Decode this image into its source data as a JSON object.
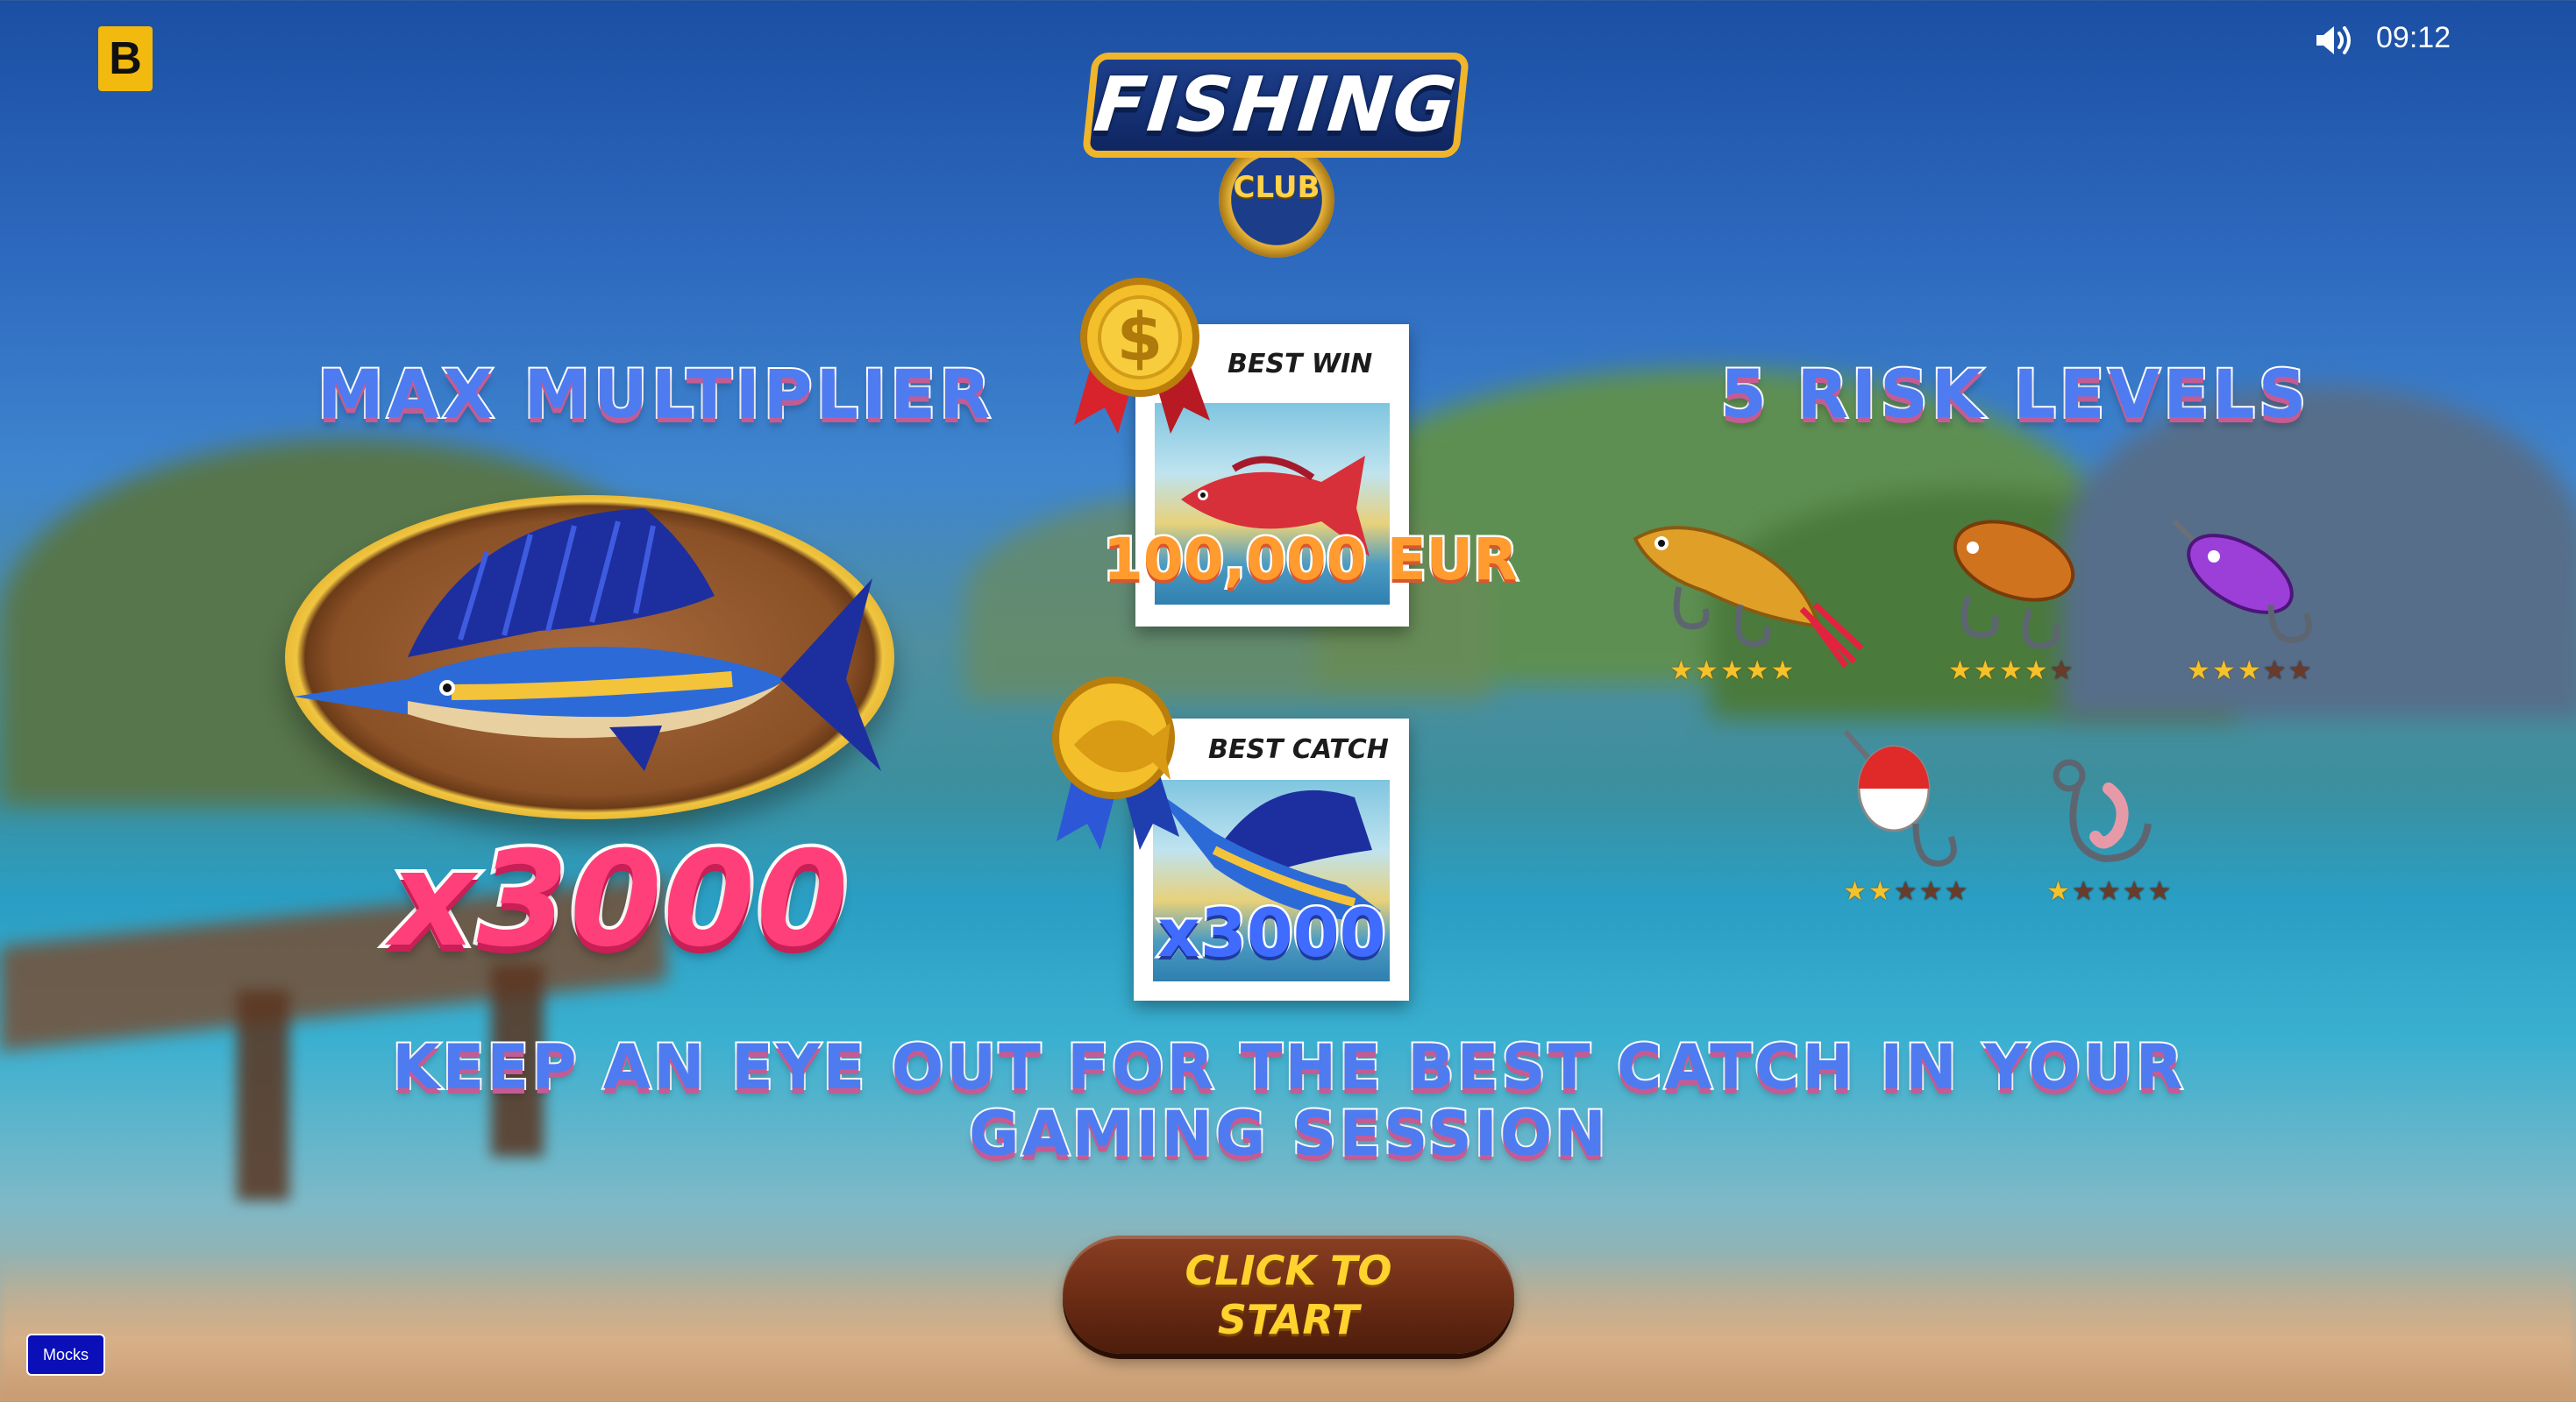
{
  "topbar": {
    "brand_letter": "B",
    "sound_icon": "speaker-on-icon",
    "time": "09:12"
  },
  "logo": {
    "title": "FISHING",
    "subtitle": "CLUB"
  },
  "left_panel": {
    "heading": "MAX MULTIPLIER",
    "multiplier": "x3000",
    "fish_icon": "sailfish-trophy-icon"
  },
  "center_panel": {
    "best_win": {
      "title": "BEST WIN",
      "value": "100,000 EUR",
      "medal_icon": "dollar-medal-icon",
      "fish_icon": "red-snapper-icon"
    },
    "best_catch": {
      "title": "BEST CATCH",
      "value": "x3000",
      "medal_icon": "fish-medal-icon",
      "fish_icon": "sailfish-icon"
    }
  },
  "right_panel": {
    "heading": "5 RISK LEVELS",
    "levels": [
      {
        "icon": "gold-fish-lure-icon",
        "stars": 5
      },
      {
        "icon": "orange-crankbait-lure-icon",
        "stars": 4
      },
      {
        "icon": "purple-lure-icon",
        "stars": 3
      },
      {
        "icon": "bobber-icon",
        "stars": 2
      },
      {
        "icon": "worm-hook-icon",
        "stars": 1
      }
    ],
    "max_stars": 5
  },
  "tagline": "KEEP AN EYE OUT FOR THE BEST CATCH IN YOUR GAMING SESSION",
  "start_button": "CLICK TO START",
  "mocks_button": "Mocks",
  "colors": {
    "headline_blue": "#4f7bf0",
    "multiplier_pink": "#ff3f7a",
    "win_orange": "#ff9b2f",
    "button_brown": "#6a2b14",
    "button_text": "#ffd22e",
    "star_on": "#f4c22b",
    "star_off": "#6b3b2a"
  }
}
